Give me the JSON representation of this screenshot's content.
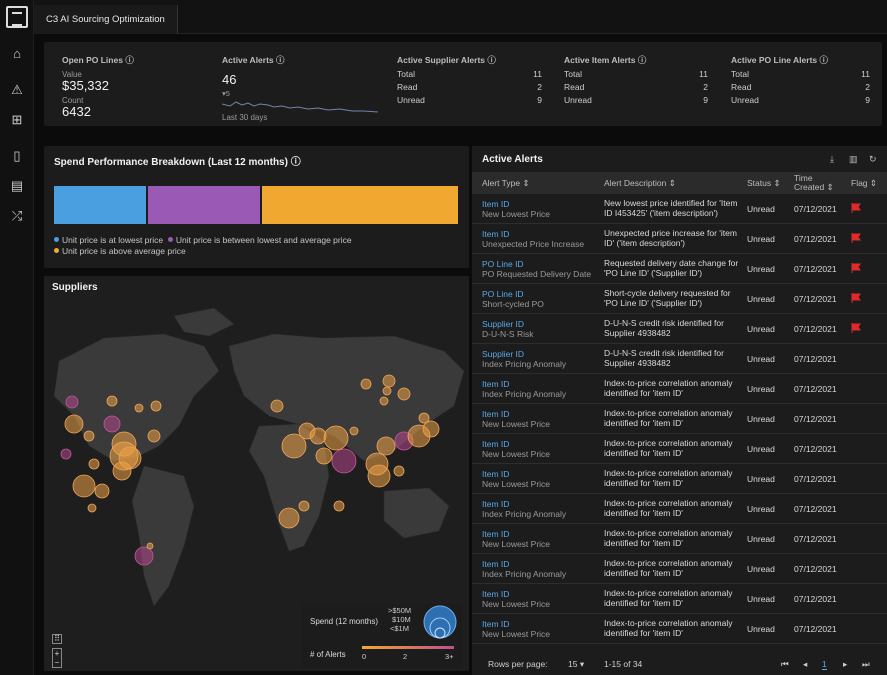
{
  "tab": {
    "title": "C3 AI Sourcing Optimization"
  },
  "kpi": {
    "open_po": {
      "label": "Open PO Lines",
      "value_label": "Value",
      "value": "$35,332",
      "count_label": "Count",
      "count": "6432"
    },
    "active_alerts": {
      "label": "Active Alerts",
      "value": "46",
      "delta": "▾5",
      "caption": "Last 30 days"
    },
    "supplier": {
      "label": "Active Supplier Alerts",
      "rows": [
        [
          "Total",
          "11"
        ],
        [
          "Read",
          "2"
        ],
        [
          "Unread",
          "9"
        ]
      ]
    },
    "item": {
      "label": "Active Item Alerts",
      "rows": [
        [
          "Total",
          "11"
        ],
        [
          "Read",
          "2"
        ],
        [
          "Unread",
          "9"
        ]
      ]
    },
    "poline": {
      "label": "Active PO Line Alerts",
      "rows": [
        [
          "Total",
          "11"
        ],
        [
          "Read",
          "2"
        ],
        [
          "Unread",
          "9"
        ]
      ]
    }
  },
  "spend": {
    "title": "Spend Performance Breakdown (Last 12 months)",
    "legend1": "Unit price is at lowest price",
    "legend2": "Unit price is between lowest and average price",
    "legend3": "Unit price is above average price",
    "colors": {
      "lowest": "#4a9fe0",
      "between": "#9b59b6",
      "above": "#f0a830"
    },
    "fractions": {
      "lowest": 0.23,
      "between": 0.28,
      "above": 0.49
    }
  },
  "suppliers": {
    "title": "Suppliers",
    "spend_label": "Spend (12 months)",
    "spend_levels": [
      ">$50M",
      "$10M",
      "<$1M"
    ],
    "alerts_label": "# of Alerts",
    "alerts_ticks": [
      "0",
      "2",
      "3+"
    ]
  },
  "alerts": {
    "title": "Active Alerts",
    "headers": {
      "type": "Alert Type ⇕",
      "desc": "Alert Description ⇕",
      "status": "Status ⇕",
      "time": "Time Created ⇕",
      "flag": "Flag ⇕"
    },
    "rows": [
      {
        "id": "Item ID",
        "type": "New Lowest Price",
        "desc": "New lowest price identified for 'Item ID I453425' ('item description')",
        "status": "Unread",
        "date": "07/12/2021",
        "flag": true
      },
      {
        "id": "Item ID",
        "type": "Unexpected Price Increase",
        "desc": "Unexpected price increase for 'item ID' ('item description')",
        "status": "Unread",
        "date": "07/12/2021",
        "flag": true
      },
      {
        "id": "PO Line ID",
        "type": "PO Requested Delivery Date",
        "desc": "Requested delivery date change for 'PO Line ID' ('Supplier ID')",
        "status": "Unread",
        "date": "07/12/2021",
        "flag": true
      },
      {
        "id": "PO Line ID",
        "type": "Short-cycled PO",
        "desc": "Short-cycle delivery requested for 'PO Line ID' ('Supplier ID')",
        "status": "Unread",
        "date": "07/12/2021",
        "flag": true
      },
      {
        "id": "Supplier ID",
        "type": "D-U-N-S Risk",
        "desc": "D-U-N-S credit risk identified for Supplier 4938482",
        "status": "Unread",
        "date": "07/12/2021",
        "flag": true
      },
      {
        "id": "Supplier ID",
        "type": "Index Pricing Anomaly",
        "desc": "D-U-N-S credit risk identified for Supplier 4938482",
        "status": "Unread",
        "date": "07/12/2021",
        "flag": false
      },
      {
        "id": "Item ID",
        "type": "Index Pricing Anomaly",
        "desc": "Index-to-price correlation anomaly identified for 'item ID'",
        "status": "Unread",
        "date": "07/12/2021",
        "flag": false
      },
      {
        "id": "Item ID",
        "type": "New Lowest Price",
        "desc": "Index-to-price correlation anomaly identified for 'item ID'",
        "status": "Unread",
        "date": "07/12/2021",
        "flag": false
      },
      {
        "id": "Item ID",
        "type": "New Lowest Price",
        "desc": "Index-to-price correlation anomaly identified for 'item ID'",
        "status": "Unread",
        "date": "07/12/2021",
        "flag": false
      },
      {
        "id": "Item ID",
        "type": "New Lowest Price",
        "desc": "Index-to-price correlation anomaly identified for 'item ID'",
        "status": "Unread",
        "date": "07/12/2021",
        "flag": false
      },
      {
        "id": "Item ID",
        "type": "Index Pricing Anomaly",
        "desc": "Index-to-price correlation anomaly identified for 'item ID'",
        "status": "Unread",
        "date": "07/12/2021",
        "flag": false
      },
      {
        "id": "Item ID",
        "type": "New Lowest Price",
        "desc": "Index-to-price correlation anomaly identified for 'item ID'",
        "status": "Unread",
        "date": "07/12/2021",
        "flag": false
      },
      {
        "id": "Item ID",
        "type": "Index Pricing Anomaly",
        "desc": "Index-to-price correlation anomaly identified for 'item ID'",
        "status": "Unread",
        "date": "07/12/2021",
        "flag": false
      },
      {
        "id": "Item ID",
        "type": "New Lowest Price",
        "desc": "Index-to-price correlation anomaly identified for 'item ID'",
        "status": "Unread",
        "date": "07/12/2021",
        "flag": false
      },
      {
        "id": "Item ID",
        "type": "New Lowest Price",
        "desc": "Index-to-price correlation anomaly identified for 'item ID'",
        "status": "Unread",
        "date": "07/12/2021",
        "flag": false
      }
    ],
    "footer": {
      "rows_label": "Rows per page:",
      "rows_value": "15",
      "range": "1-15 of 34",
      "page": "1"
    }
  }
}
